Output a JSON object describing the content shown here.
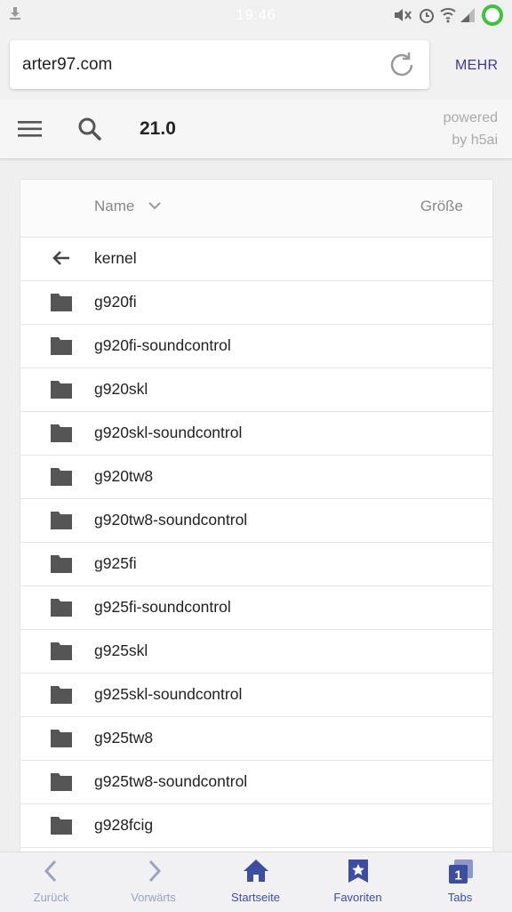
{
  "status_bar": {
    "time": "19:46"
  },
  "browser": {
    "url": "arter97.com",
    "more_label": "MEHR"
  },
  "h5ai": {
    "breadcrumb": "21.0",
    "powered_line1": "powered",
    "powered_line2": "by h5ai"
  },
  "file_list": {
    "header": {
      "name": "Name",
      "size": "Größe"
    },
    "parent": "kernel",
    "folders": [
      "g920fi",
      "g920fi-soundcontrol",
      "g920skl",
      "g920skl-soundcontrol",
      "g920tw8",
      "g920tw8-soundcontrol",
      "g925fi",
      "g925fi-soundcontrol",
      "g925skl",
      "g925skl-soundcontrol",
      "g925tw8",
      "g925tw8-soundcontrol",
      "g928fcig"
    ]
  },
  "bottom_nav": {
    "back": "Zurück",
    "forward": "Vorwärts",
    "home": "Startseite",
    "favorites": "Favoriten",
    "tabs": "Tabs",
    "tab_count": "1"
  },
  "colors": {
    "accent": "#3d4ea0",
    "inactive": "#9aa3c4",
    "folder": "#555555"
  }
}
